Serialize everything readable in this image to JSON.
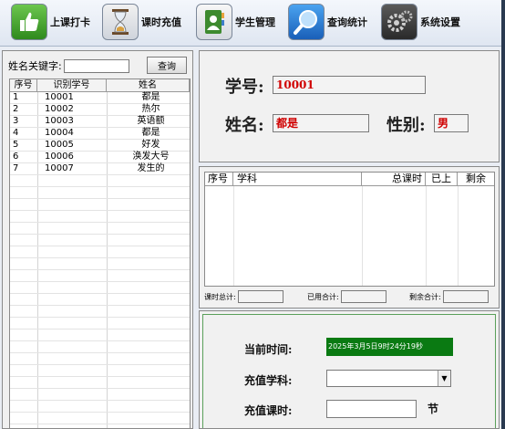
{
  "toolbar": {
    "buttons": [
      {
        "label": "上课打卡",
        "icon": "thumbs-up-icon"
      },
      {
        "label": "课时充值",
        "icon": "hourglass-icon"
      },
      {
        "label": "学生管理",
        "icon": "contact-book-icon"
      },
      {
        "label": "查询统计",
        "icon": "magnifier-icon"
      },
      {
        "label": "系统设置",
        "icon": "gears-icon"
      }
    ]
  },
  "student_list": {
    "search_label": "姓名关键字:",
    "search_value": "",
    "query_button": "查询",
    "columns": [
      "序号",
      "识别学号",
      "姓名"
    ],
    "rows": [
      [
        "1",
        "10001",
        "都是"
      ],
      [
        "2",
        "10002",
        "热尔"
      ],
      [
        "3",
        "10003",
        "英语额"
      ],
      [
        "4",
        "10004",
        "都是"
      ],
      [
        "5",
        "10005",
        "好发"
      ],
      [
        "6",
        "10006",
        "涣发大号"
      ],
      [
        "7",
        "10007",
        "发生的"
      ]
    ]
  },
  "student_info": {
    "id_label": "学号:",
    "id_value": "10001",
    "name_label": "姓名:",
    "name_value": "都是",
    "gender_label": "性别:",
    "gender_value": "男"
  },
  "subjects": {
    "columns": [
      "序号",
      "学科",
      "总课时",
      "已上",
      "剩余"
    ],
    "rows": [],
    "total_label": "课时总计:",
    "used_label": "已用合计:",
    "remain_label": "剩余合计:",
    "total_value": "",
    "used_value": "",
    "remain_value": ""
  },
  "recharge": {
    "time_label": "当前时间:",
    "time_value": "2025年3月5日9时24分19秒",
    "subject_label": "充值学科:",
    "subject_value": "",
    "hours_label": "充值课时:",
    "hours_value": "",
    "hours_unit": "节"
  },
  "colors": {
    "accent_red": "#d00000",
    "time_bg": "#0a7a12"
  }
}
